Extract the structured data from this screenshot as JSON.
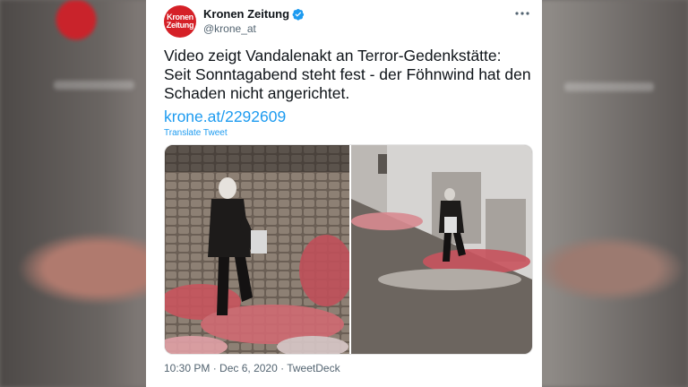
{
  "account": {
    "avatar_line1": "Kronen",
    "avatar_line2": "Zeitung",
    "name": "Kronen Zeitung",
    "handle": "@krone_at"
  },
  "icons": {
    "verified": "verified-badge-icon",
    "more": "more-options-icon"
  },
  "tweet": {
    "text": "Video zeigt Vandalenakt an Terror-Gedenkstätte: Seit Sonntagabend steht fest - der Föhnwind hat den Schaden nicht angerichtet.",
    "link": "krone.at/2292609",
    "translate": "Translate Tweet",
    "time": "10:30 PM",
    "separator": " · ",
    "date": "Dec 6, 2020",
    "source": "TweetDeck"
  },
  "colors": {
    "brand_red": "#d52027",
    "link_blue": "#1d9bf0",
    "verified_blue": "#1d9bf0"
  }
}
